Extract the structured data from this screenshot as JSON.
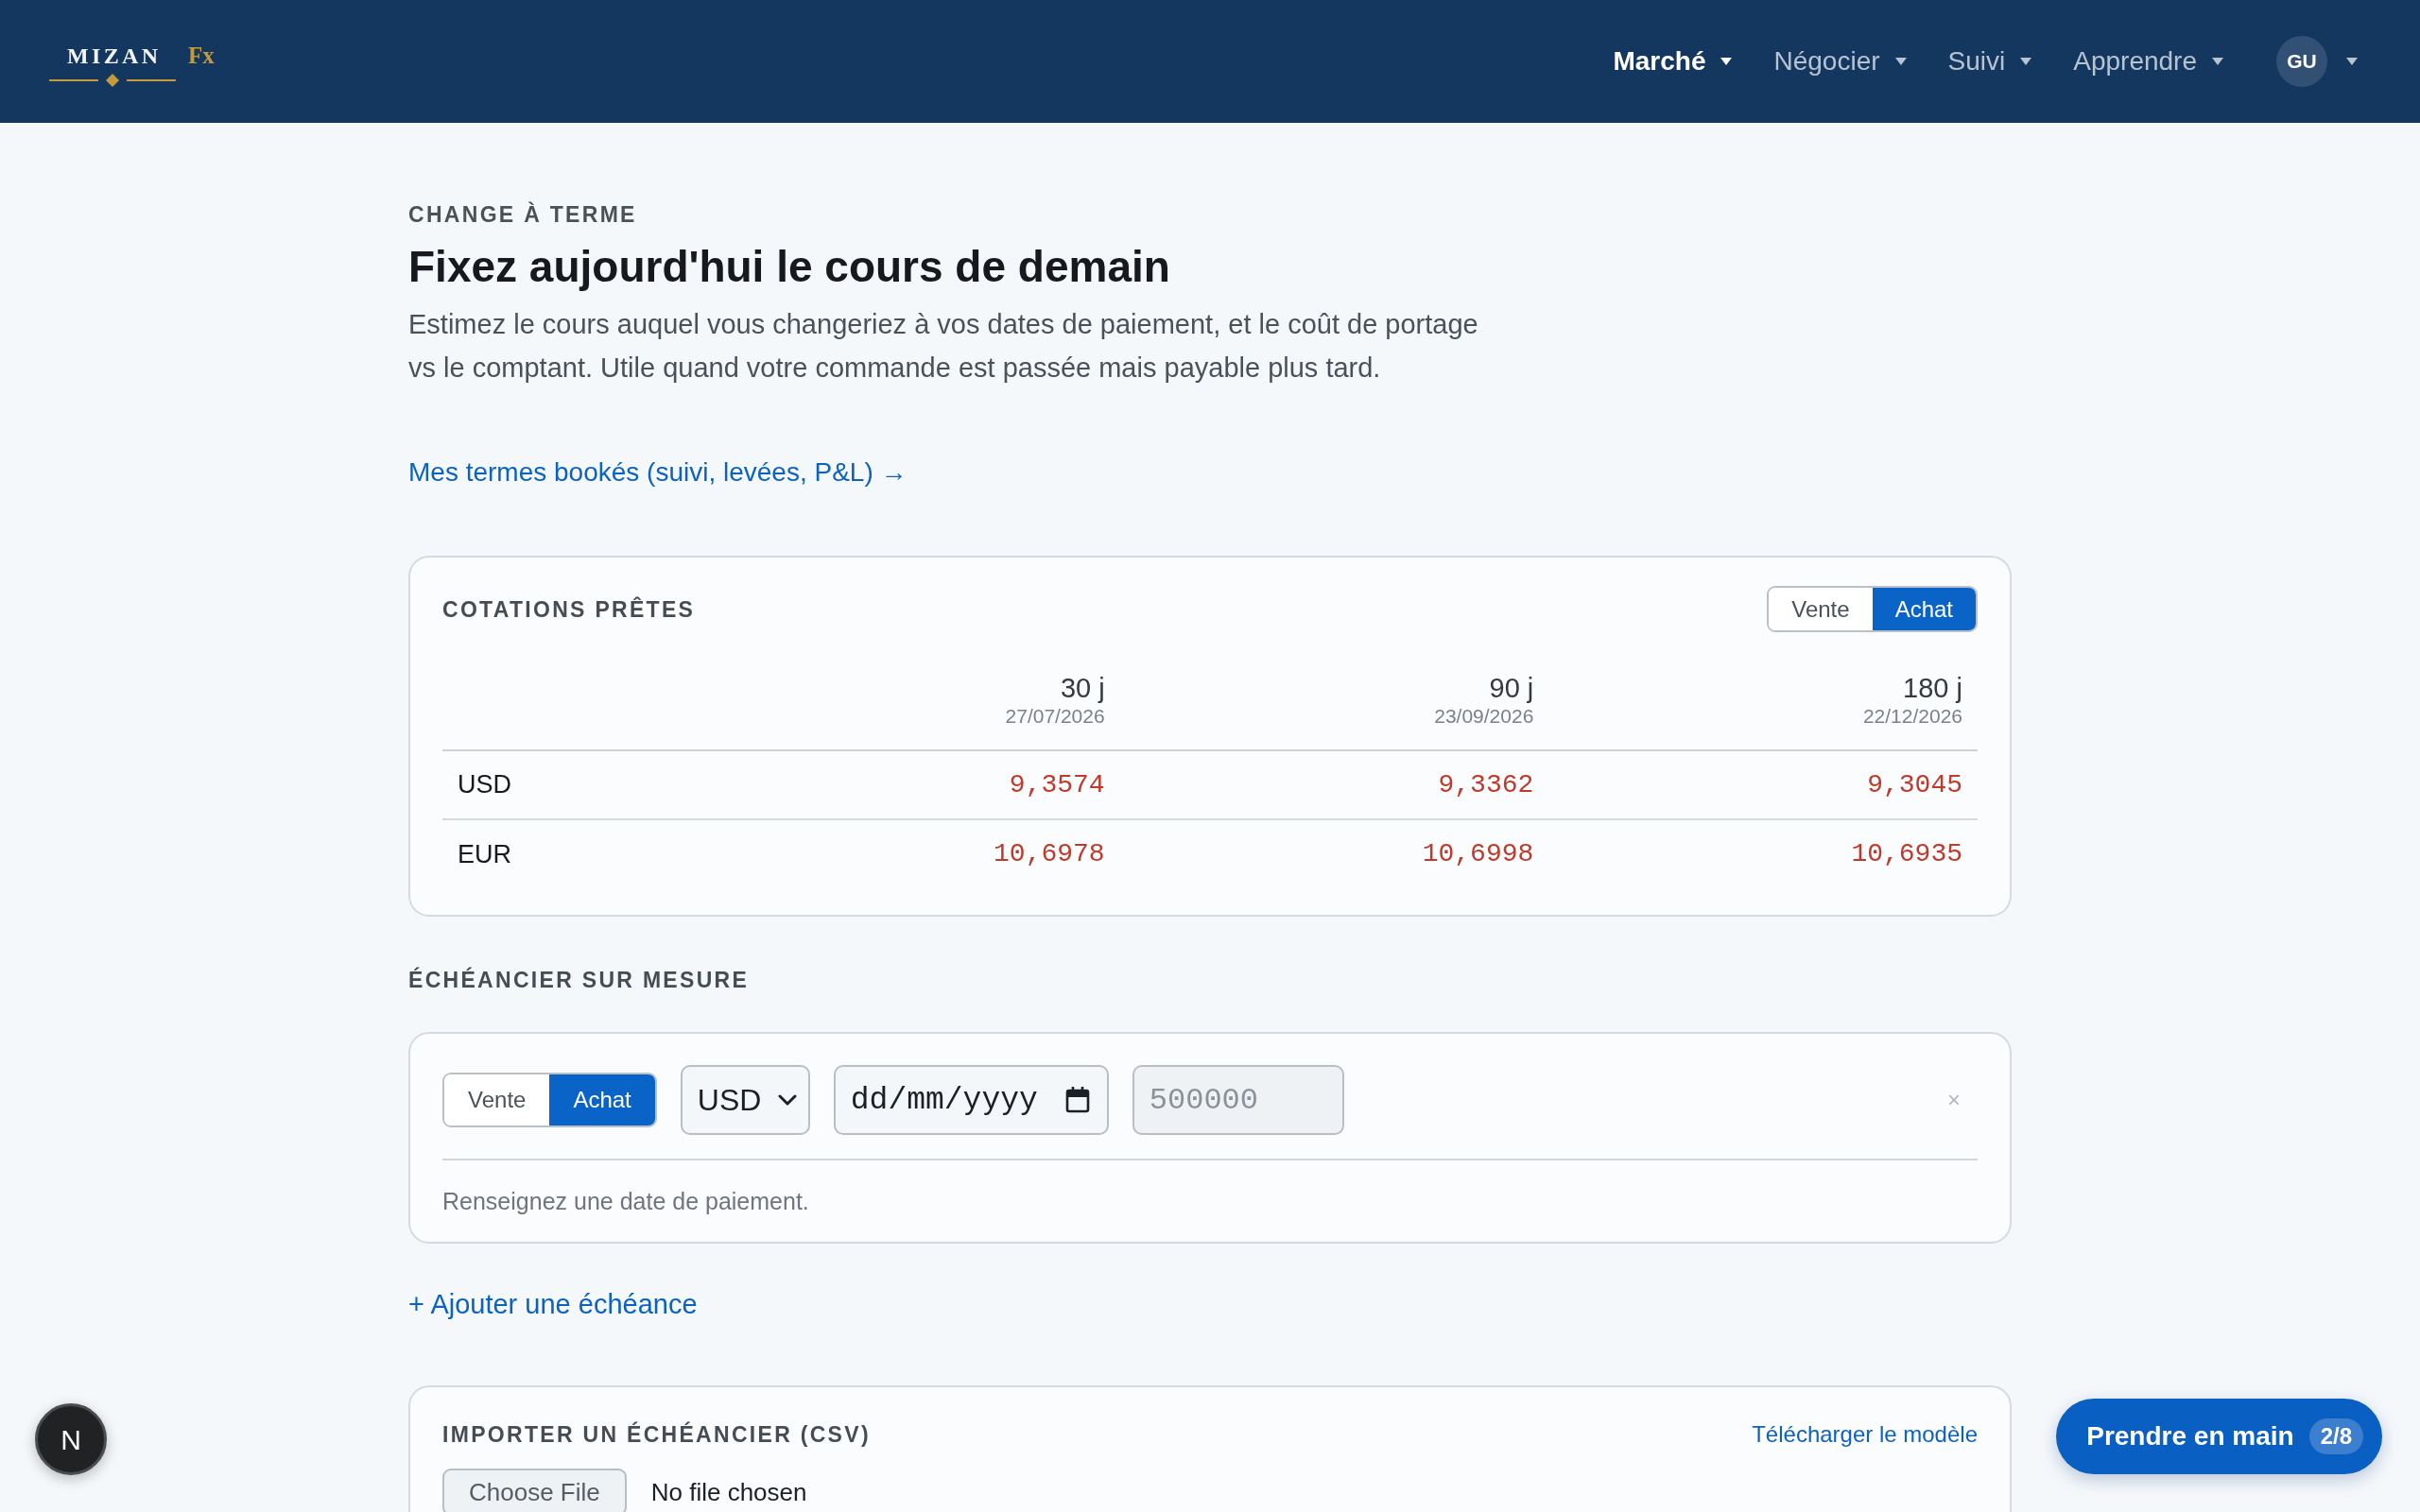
{
  "navbar": {
    "logo": {
      "name": "MIZAN",
      "suffix": "Fx"
    },
    "menu": [
      {
        "label": "Marché",
        "selected": true
      },
      {
        "label": "Négocier",
        "selected": false
      },
      {
        "label": "Suivi",
        "selected": false
      },
      {
        "label": "Apprendre",
        "selected": false
      }
    ],
    "user": {
      "initials": "GU"
    }
  },
  "header": {
    "eyebrow": "CHANGE À TERME",
    "title": "Fixez aujourd'hui le cours de demain",
    "description": "Estimez le cours auquel vous changeriez à vos dates de paiement, et le coût de portage vs le comptant. Utile quand votre commande est passée mais payable plus tard.",
    "link": "Mes termes bookés (suivi, levées, P&L) →"
  },
  "quotes": {
    "title": "COTATIONS PRÊTES",
    "side_toggle": [
      {
        "label": "Vente",
        "selected": false
      },
      {
        "label": "Achat",
        "selected": true
      }
    ],
    "columns": [
      {
        "tenor": "30 j",
        "date": "27/07/2026"
      },
      {
        "tenor": "90 j",
        "date": "23/09/2026"
      },
      {
        "tenor": "180 j",
        "date": "22/12/2026"
      }
    ],
    "rows": [
      {
        "currency": "USD",
        "values": [
          "9,3574",
          "9,3362",
          "9,3045"
        ]
      },
      {
        "currency": "EUR",
        "values": [
          "10,6978",
          "10,6998",
          "10,6935"
        ]
      }
    ]
  },
  "schedule": {
    "title": "ÉCHÉANCIER SUR MESURE",
    "lines": [
      {
        "side_toggle": [
          {
            "label": "Vente",
            "selected": false
          },
          {
            "label": "Achat",
            "selected": true
          }
        ],
        "currency": "USD",
        "date": {
          "placeholder": "dd/mm/yyyy"
        },
        "amount": {
          "placeholder": "500000"
        },
        "remove": "×",
        "hint": "Renseignez une date de paiement."
      }
    ],
    "add_link": "+ Ajouter une échéance"
  },
  "import": {
    "title": "IMPORTER UN ÉCHÉANCIER (CSV)",
    "template_link": "Télécharger le modèle",
    "file_button": "Choose File",
    "file_status": "No file chosen"
  },
  "dev_indicator": {
    "letter": "N"
  },
  "tour_button": {
    "label": "Prendre en main",
    "step": "2/8"
  }
}
